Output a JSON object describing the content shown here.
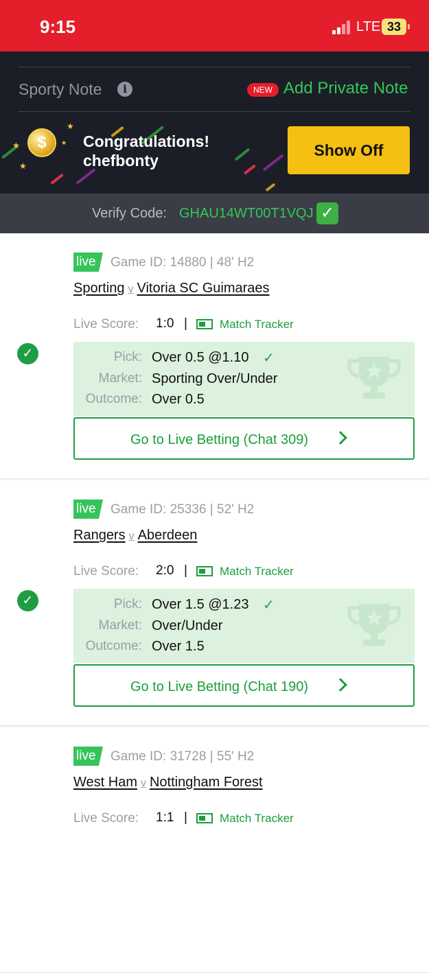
{
  "status_bar": {
    "time": "9:15",
    "network": "LTE",
    "battery": "33"
  },
  "header": {
    "sporty_note": "Sporty Note",
    "new_badge": "NEW",
    "add_note": "Add Private Note",
    "congrats_title": "Congratulations!",
    "congrats_user": "chefbonty",
    "show_off": "Show Off"
  },
  "verify": {
    "label": "Verify Code:",
    "code": "GHAU14WT00T1VQJ"
  },
  "labels": {
    "live": "live",
    "live_score": "Live Score:",
    "match_tracker": "Match Tracker",
    "pick": "Pick:",
    "market": "Market:",
    "outcome": "Outcome:",
    "versus": "v"
  },
  "bets": [
    {
      "game_id": "Game ID: 14880 | 48' H2",
      "home": "Sporting",
      "away": "Vitoria SC Guimaraes",
      "score": "1:0",
      "pick": "Over 0.5 @1.10",
      "market": "Sporting Over/Under",
      "outcome": "Over 0.5",
      "button": "Go to Live Betting (Chat 309)"
    },
    {
      "game_id": "Game ID: 25336 | 52' H2",
      "home": "Rangers",
      "away": "Aberdeen",
      "score": "2:0",
      "pick": "Over 1.5 @1.23",
      "market": "Over/Under",
      "outcome": "Over 1.5",
      "button": "Go to Live Betting (Chat 190)"
    },
    {
      "game_id": "Game ID: 31728 | 55' H2",
      "home": "West Ham",
      "away": "Nottingham Forest",
      "score": "1:1"
    }
  ],
  "icons": [
    "info-icon",
    "coin-icon",
    "check-icon",
    "tracker-icon",
    "trophy-icon",
    "chevron-right-icon"
  ],
  "colors": {
    "status_bar": "#e41e2b",
    "accent_green": "#1a9e3c",
    "live_green": "#36c45a",
    "show_off": "#f5c013",
    "dark_bg": "#1b1e26"
  }
}
